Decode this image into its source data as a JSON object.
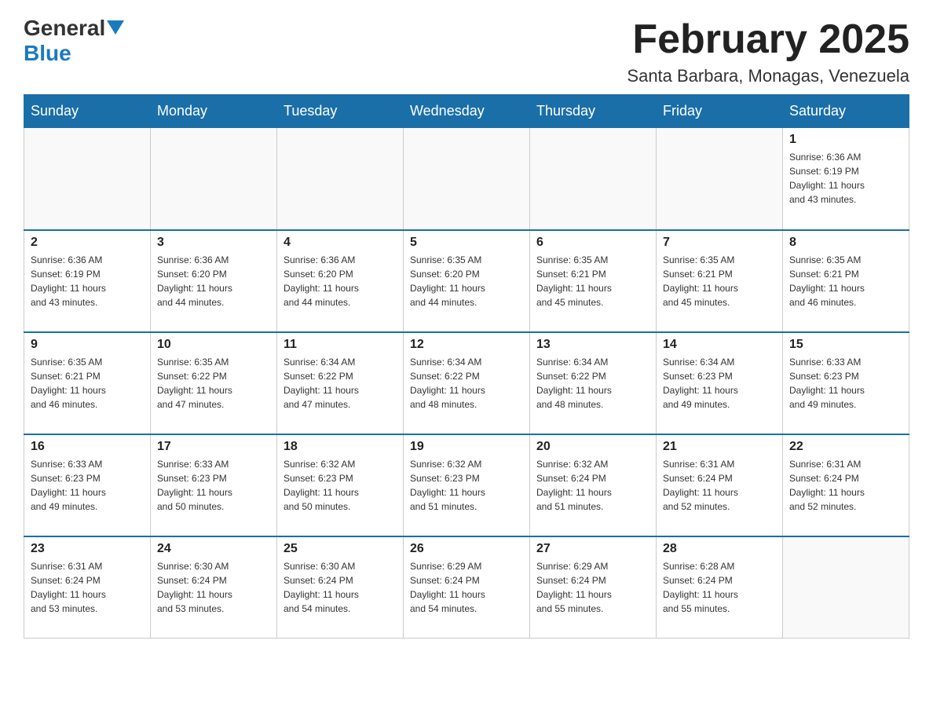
{
  "header": {
    "logo_general": "General",
    "logo_blue": "Blue",
    "month_title": "February 2025",
    "location": "Santa Barbara, Monagas, Venezuela"
  },
  "days_of_week": [
    "Sunday",
    "Monday",
    "Tuesday",
    "Wednesday",
    "Thursday",
    "Friday",
    "Saturday"
  ],
  "weeks": [
    [
      {
        "day": "",
        "info": ""
      },
      {
        "day": "",
        "info": ""
      },
      {
        "day": "",
        "info": ""
      },
      {
        "day": "",
        "info": ""
      },
      {
        "day": "",
        "info": ""
      },
      {
        "day": "",
        "info": ""
      },
      {
        "day": "1",
        "info": "Sunrise: 6:36 AM\nSunset: 6:19 PM\nDaylight: 11 hours\nand 43 minutes."
      }
    ],
    [
      {
        "day": "2",
        "info": "Sunrise: 6:36 AM\nSunset: 6:19 PM\nDaylight: 11 hours\nand 43 minutes."
      },
      {
        "day": "3",
        "info": "Sunrise: 6:36 AM\nSunset: 6:20 PM\nDaylight: 11 hours\nand 44 minutes."
      },
      {
        "day": "4",
        "info": "Sunrise: 6:36 AM\nSunset: 6:20 PM\nDaylight: 11 hours\nand 44 minutes."
      },
      {
        "day": "5",
        "info": "Sunrise: 6:35 AM\nSunset: 6:20 PM\nDaylight: 11 hours\nand 44 minutes."
      },
      {
        "day": "6",
        "info": "Sunrise: 6:35 AM\nSunset: 6:21 PM\nDaylight: 11 hours\nand 45 minutes."
      },
      {
        "day": "7",
        "info": "Sunrise: 6:35 AM\nSunset: 6:21 PM\nDaylight: 11 hours\nand 45 minutes."
      },
      {
        "day": "8",
        "info": "Sunrise: 6:35 AM\nSunset: 6:21 PM\nDaylight: 11 hours\nand 46 minutes."
      }
    ],
    [
      {
        "day": "9",
        "info": "Sunrise: 6:35 AM\nSunset: 6:21 PM\nDaylight: 11 hours\nand 46 minutes."
      },
      {
        "day": "10",
        "info": "Sunrise: 6:35 AM\nSunset: 6:22 PM\nDaylight: 11 hours\nand 47 minutes."
      },
      {
        "day": "11",
        "info": "Sunrise: 6:34 AM\nSunset: 6:22 PM\nDaylight: 11 hours\nand 47 minutes."
      },
      {
        "day": "12",
        "info": "Sunrise: 6:34 AM\nSunset: 6:22 PM\nDaylight: 11 hours\nand 48 minutes."
      },
      {
        "day": "13",
        "info": "Sunrise: 6:34 AM\nSunset: 6:22 PM\nDaylight: 11 hours\nand 48 minutes."
      },
      {
        "day": "14",
        "info": "Sunrise: 6:34 AM\nSunset: 6:23 PM\nDaylight: 11 hours\nand 49 minutes."
      },
      {
        "day": "15",
        "info": "Sunrise: 6:33 AM\nSunset: 6:23 PM\nDaylight: 11 hours\nand 49 minutes."
      }
    ],
    [
      {
        "day": "16",
        "info": "Sunrise: 6:33 AM\nSunset: 6:23 PM\nDaylight: 11 hours\nand 49 minutes."
      },
      {
        "day": "17",
        "info": "Sunrise: 6:33 AM\nSunset: 6:23 PM\nDaylight: 11 hours\nand 50 minutes."
      },
      {
        "day": "18",
        "info": "Sunrise: 6:32 AM\nSunset: 6:23 PM\nDaylight: 11 hours\nand 50 minutes."
      },
      {
        "day": "19",
        "info": "Sunrise: 6:32 AM\nSunset: 6:23 PM\nDaylight: 11 hours\nand 51 minutes."
      },
      {
        "day": "20",
        "info": "Sunrise: 6:32 AM\nSunset: 6:24 PM\nDaylight: 11 hours\nand 51 minutes."
      },
      {
        "day": "21",
        "info": "Sunrise: 6:31 AM\nSunset: 6:24 PM\nDaylight: 11 hours\nand 52 minutes."
      },
      {
        "day": "22",
        "info": "Sunrise: 6:31 AM\nSunset: 6:24 PM\nDaylight: 11 hours\nand 52 minutes."
      }
    ],
    [
      {
        "day": "23",
        "info": "Sunrise: 6:31 AM\nSunset: 6:24 PM\nDaylight: 11 hours\nand 53 minutes."
      },
      {
        "day": "24",
        "info": "Sunrise: 6:30 AM\nSunset: 6:24 PM\nDaylight: 11 hours\nand 53 minutes."
      },
      {
        "day": "25",
        "info": "Sunrise: 6:30 AM\nSunset: 6:24 PM\nDaylight: 11 hours\nand 54 minutes."
      },
      {
        "day": "26",
        "info": "Sunrise: 6:29 AM\nSunset: 6:24 PM\nDaylight: 11 hours\nand 54 minutes."
      },
      {
        "day": "27",
        "info": "Sunrise: 6:29 AM\nSunset: 6:24 PM\nDaylight: 11 hours\nand 55 minutes."
      },
      {
        "day": "28",
        "info": "Sunrise: 6:28 AM\nSunset: 6:24 PM\nDaylight: 11 hours\nand 55 minutes."
      },
      {
        "day": "",
        "info": ""
      }
    ]
  ]
}
